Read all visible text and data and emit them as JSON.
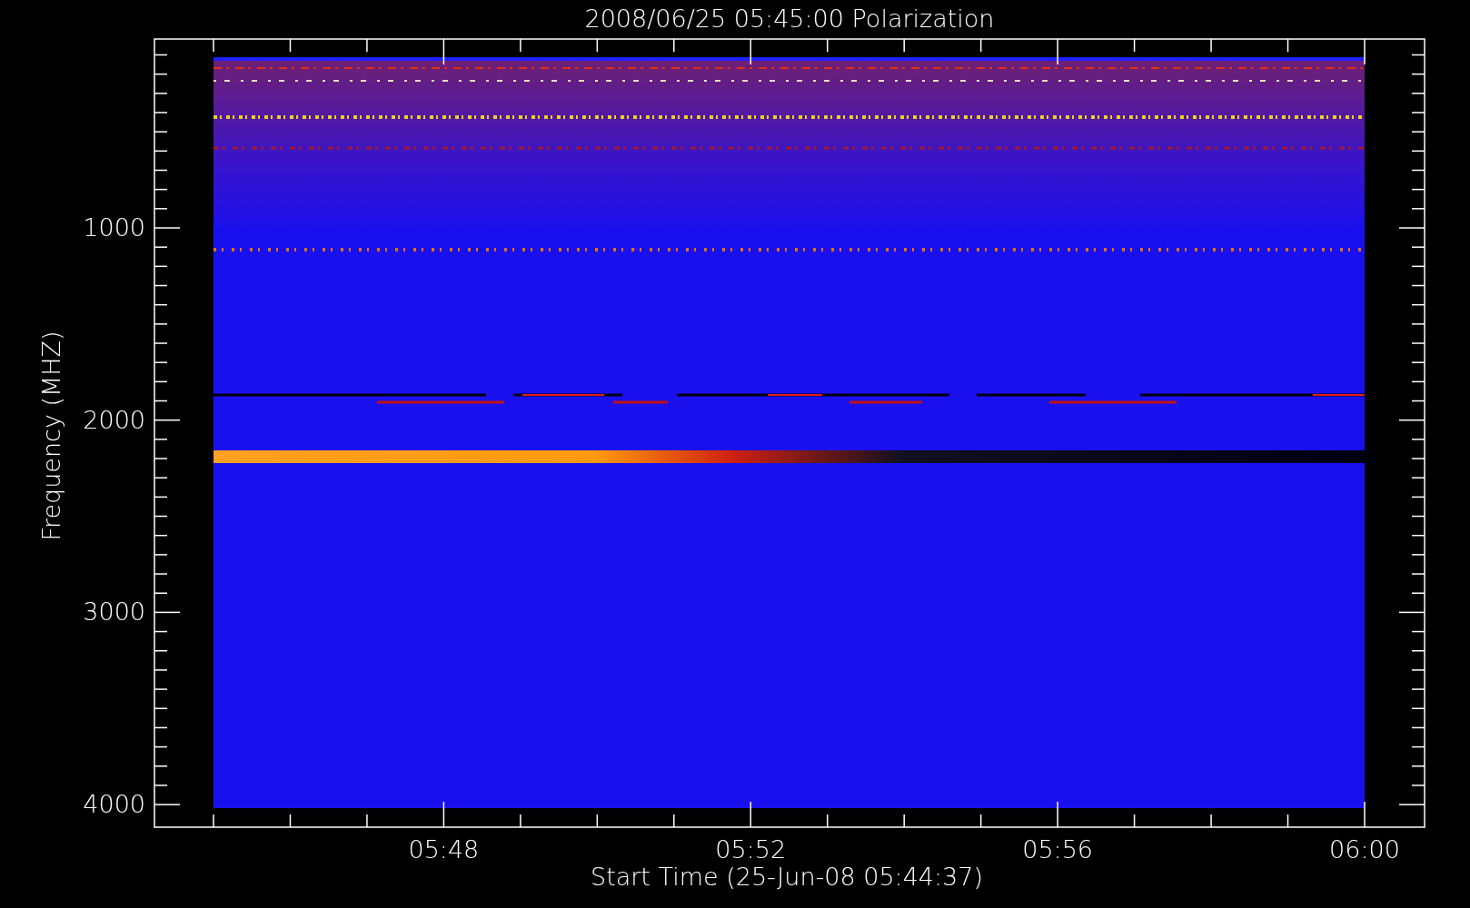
{
  "plot": {
    "title": "2008/06/25 05:45:00 Polarization",
    "ylabel": "Frequency (MHZ)",
    "yticks": [
      "1000",
      "2000",
      "3000",
      "4000"
    ],
    "xlabel": "Start Time (25-Jun-08 05:44:37)",
    "xticks": [
      "05:48",
      "05:52",
      "05:56",
      "06:00"
    ]
  }
}
